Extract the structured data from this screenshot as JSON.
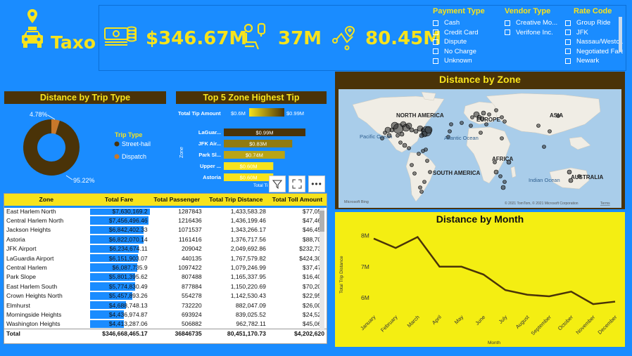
{
  "brand": {
    "name": "Taxo",
    "pin_icon": "location-pin-icon",
    "car_icon": "taxi-icon"
  },
  "kpis": [
    {
      "icon": "money-stack-icon",
      "value": "$346.67M"
    },
    {
      "icon": "passenger-seat-icon",
      "value": "37M"
    },
    {
      "icon": "route-icon",
      "value": "80.45M"
    }
  ],
  "slicers": {
    "payment_type": {
      "title": "Payment Type",
      "items": [
        "Cash",
        "Credit Card",
        "Dispute",
        "No Charge",
        "Unknown"
      ]
    },
    "vendor_type": {
      "title": "Vendor Type",
      "items": [
        "Creative Mo...",
        "Verifone Inc."
      ]
    },
    "rate_code": {
      "title": "Rate Code",
      "items": [
        "Group Ride",
        "JFK",
        "Nassau/Westc...",
        "Negotiated Fare",
        "Newark"
      ]
    }
  },
  "colors": {
    "background": "#1a8cff",
    "accent": "#f7e31c",
    "title_bar": "#4a3308",
    "donut_primary": "#4a3308",
    "donut_secondary": "#c8782a",
    "line_bg": "#f4ee12"
  },
  "donut": {
    "title": "Distance by Trip Type",
    "legend_title": "Trip Type",
    "chart_data": {
      "type": "pie",
      "labels": [
        "Street-hail",
        "Dispatch"
      ],
      "values": [
        95.22,
        4.78
      ],
      "data_labels": [
        "95.22%",
        "4.78%"
      ]
    }
  },
  "top5": {
    "title": "Top 5 Zone Highest Tip",
    "legend_label": "Total Tip Amount",
    "legend_min": "$0.6M",
    "legend_max": "$0.99M",
    "axis_label": "Zone",
    "footer": "Total Ti",
    "chart_data": {
      "type": "bar",
      "categories": [
        "LaGuar...",
        "JFK Air...",
        "Park Sl...",
        "Upper ...",
        "Astoria"
      ],
      "values": [
        0.99,
        0.83,
        0.74,
        0.6,
        0.6
      ],
      "data_labels": [
        "$0.99M",
        "$0.83M",
        "$0.74M",
        "$0.60M",
        "$0.60M"
      ]
    }
  },
  "map": {
    "title": "Distance by Zone",
    "labels": {
      "na": "NORTH AMERICA",
      "eu": "EUROPE",
      "as": "ASIA",
      "pac": "Pacific Ocean",
      "atl": "Atlantic Ocean",
      "af": "AFRICA",
      "sa": "SOUTH AMERICA",
      "ind": "Indian Ocean",
      "au": "AUSTRALIA"
    },
    "attribution_left": "Microsoft Bing",
    "attribution_right": "© 2021 TomTom, © 2021 Microsoft Corporation",
    "attribution_terms": "Terms"
  },
  "line": {
    "title": "Distance by Month",
    "ylabel": "Total Trip Distance",
    "xlabel": "Month",
    "chart_data": {
      "type": "line",
      "categories": [
        "January",
        "February",
        "March",
        "April",
        "May",
        "June",
        "July",
        "August",
        "September",
        "October",
        "November",
        "December"
      ],
      "values": [
        7.9,
        7.6,
        7.95,
        7.0,
        7.0,
        6.75,
        6.25,
        6.1,
        6.05,
        6.2,
        5.8,
        5.88
      ],
      "y_ticks": [
        "8M",
        "7M",
        "6M"
      ],
      "ylim": [
        5.6,
        8.3
      ]
    }
  },
  "table": {
    "toolbar": {
      "filter_icon": "filter-icon",
      "focus_icon": "focus-mode-icon",
      "more_icon": "more-options-icon"
    },
    "columns": [
      "Zone",
      "Total Fare",
      "Total Passenger",
      "Total Trip Distance",
      "Total Toll Amount"
    ],
    "bar_max": 7630169.2,
    "rows": [
      {
        "zone": "East Harlem North",
        "fare": "$7,630,169.2",
        "fare_value": 7630169.2,
        "passenger": "1287843",
        "distance": "1,433,583.28",
        "toll": "$77,053"
      },
      {
        "zone": "Central Harlem North",
        "fare": "$7,456,496.46",
        "fare_value": 7456496.46,
        "passenger": "1216436",
        "distance": "1,436,199.46",
        "toll": "$47,467"
      },
      {
        "zone": "Jackson Heights",
        "fare": "$6,842,402.33",
        "fare_value": 6842402.33,
        "passenger": "1071537",
        "distance": "1,343,266.17",
        "toll": "$46,458"
      },
      {
        "zone": "Astoria",
        "fare": "$6,822,070.14",
        "fare_value": 6822070.14,
        "passenger": "1161416",
        "distance": "1,376,717.56",
        "toll": "$88,706"
      },
      {
        "zone": "JFK Airport",
        "fare": "$6,234,674.11",
        "fare_value": 6234674.11,
        "passenger": "209042",
        "distance": "2,049,692.86",
        "toll": "$232,737"
      },
      {
        "zone": "LaGuardia Airport",
        "fare": "$6,151,903.07",
        "fare_value": 6151903.07,
        "passenger": "440135",
        "distance": "1,767,579.82",
        "toll": "$424,301"
      },
      {
        "zone": "Central Harlem",
        "fare": "$6,087,735.9",
        "fare_value": 6087735.9,
        "passenger": "1097422",
        "distance": "1,079,246.99",
        "toll": "$37,476"
      },
      {
        "zone": "Park Slope",
        "fare": "$5,801,395.62",
        "fare_value": 5801395.62,
        "passenger": "807488",
        "distance": "1,165,337.95",
        "toll": "$16,405"
      },
      {
        "zone": "East Harlem South",
        "fare": "$5,774,830.49",
        "fare_value": 5774830.49,
        "passenger": "877884",
        "distance": "1,150,220.69",
        "toll": "$70,204"
      },
      {
        "zone": "Crown Heights North",
        "fare": "$5,457,893.26",
        "fare_value": 5457893.26,
        "passenger": "554278",
        "distance": "1,142,530.43",
        "toll": "$22,959"
      },
      {
        "zone": "Elmhurst",
        "fare": "$4,688,748.13",
        "fare_value": 4688748.13,
        "passenger": "732220",
        "distance": "882,047.09",
        "toll": "$26,008"
      },
      {
        "zone": "Morningside Heights",
        "fare": "$4,436,974.87",
        "fare_value": 4436974.87,
        "passenger": "693924",
        "distance": "839,025.52",
        "toll": "$24,523"
      },
      {
        "zone": "Washington Heights",
        "fare": "$4,413,287.06",
        "fare_value": 4413287.06,
        "passenger": "506882",
        "distance": "962,782.11",
        "toll": "$45,067"
      }
    ],
    "total": {
      "zone": "Total",
      "fare": "$346,668,465.17",
      "passenger": "36846735",
      "distance": "80,451,170.73",
      "toll": "$4,202,620"
    }
  }
}
